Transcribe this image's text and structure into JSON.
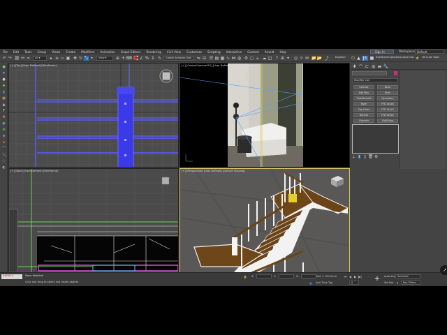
{
  "menu": [
    "File",
    "Edit",
    "Tools",
    "Group",
    "Views",
    "Create",
    "Modifiers",
    "Animation",
    "Graph Editors",
    "Rendering",
    "Civil View",
    "Customize",
    "Scripting",
    "Interactive",
    "Content",
    "Arnold",
    "Help"
  ],
  "signin": {
    "label": "Sign In"
  },
  "workspaces": {
    "label": "Workspaces:",
    "value": "Default"
  },
  "toolbar": {
    "view_dropdown": "View",
    "selection_set": "Create Selection Set",
    "explorer": "Explorer"
  },
  "cmd_top": {
    "path": "3dsMax/Scripts/Auto-Save Games/ts",
    "tab": "VerCube Tools"
  },
  "viewports": {
    "top_left": {
      "label": "[+] [Top] [User Defined] [Wireframe]"
    },
    "top_right": {
      "label": "[+] [ControlCamera001] [User Defined] [Default Shading]"
    },
    "bottom_left": {
      "label": "[+] [Back] [User Defined] [Wireframe]"
    },
    "bottom_right": {
      "label": "[+] [Perspective] [User Defined] [Default Shading]"
    }
  },
  "command_panel": {
    "modifier_list": "Modifier List",
    "buttons": [
      "Extrude",
      "Bend",
      "Edit Poly",
      "Shell",
      "TurboSmooth",
      "Symmetry",
      "Taper",
      "FFD 4x4x4",
      "Cap Holes",
      "FFD 3x3x3",
      "Normal",
      "FFD 2x2x2",
      "Chamfer",
      "UVW Map"
    ]
  },
  "status": {
    "object": "None Selected",
    "prompt": "Click and drag to select and rotate objects",
    "script_box": "ЗАПИСЬ",
    "x_label": "X:",
    "y_label": "Y:",
    "z_label": "Z:",
    "grid": "Grid = 100,0mm",
    "add_time_tag": "Add Time Tag",
    "frame": "0",
    "autokey": "Auto Key",
    "selected": "Selected",
    "setkey": "Set Key",
    "keyfilters": "Key Filters..."
  }
}
